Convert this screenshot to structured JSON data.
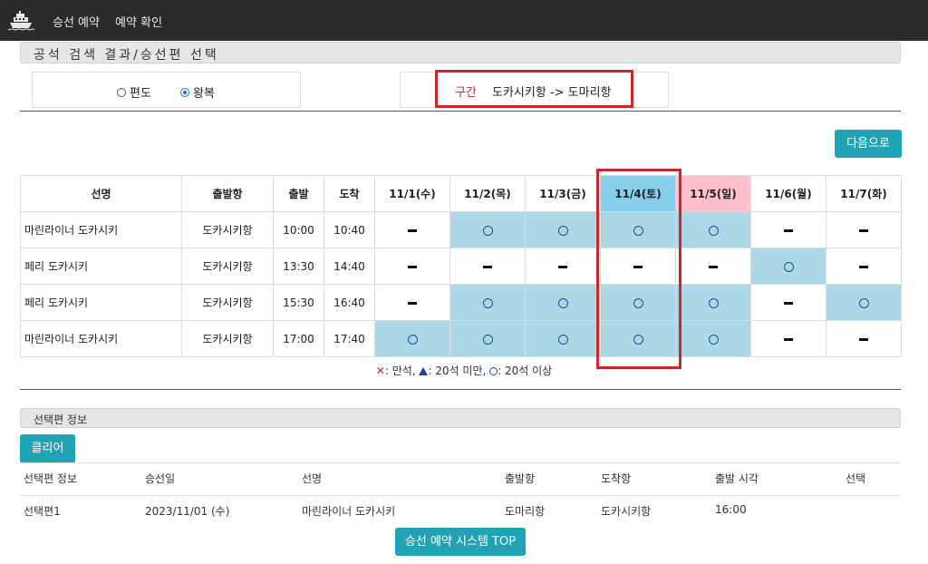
{
  "nav": {
    "logo_icon": "ship-icon",
    "items": [
      "승선 예약",
      "예약 확인"
    ]
  },
  "search": {
    "title": "공석 검색 결과/승선편 선택",
    "trip_options": [
      {
        "label": "편도",
        "checked": false
      },
      {
        "label": "왕복",
        "checked": true
      }
    ],
    "route_label": "구간",
    "route_value": "도카시키항 -> 도마리항",
    "next_button": "다음으로"
  },
  "schedule": {
    "headers": [
      "선명",
      "출발항",
      "출발",
      "도착"
    ],
    "dates": [
      "11/1(수)",
      "11/2(목)",
      "11/3(금)",
      "11/4(토)",
      "11/5(일)",
      "11/6(월)",
      "11/7(화)"
    ],
    "selected_date_index": 3,
    "sunday_index": 4,
    "rows": [
      {
        "ship": "마린라이너 도카시키",
        "port": "도카시키항",
        "dep": "10:00",
        "arr": "10:40",
        "status": [
          "dash",
          "circle",
          "circle",
          "circle",
          "circle",
          "dash",
          "dash"
        ]
      },
      {
        "ship": "페리 도카시키",
        "port": "도카시키항",
        "dep": "13:30",
        "arr": "14:40",
        "status": [
          "dash",
          "dash",
          "dash",
          "dash",
          "dash",
          "circle",
          "dash"
        ]
      },
      {
        "ship": "페리 도카시키",
        "port": "도카시키항",
        "dep": "15:30",
        "arr": "16:40",
        "status": [
          "dash",
          "circle",
          "circle",
          "circle",
          "circle",
          "dash",
          "circle"
        ]
      },
      {
        "ship": "마린라이너 도카시키",
        "port": "도카시키항",
        "dep": "17:00",
        "arr": "17:40",
        "status": [
          "circle",
          "circle",
          "circle",
          "circle",
          "circle",
          "dash",
          "dash"
        ]
      }
    ],
    "legend": {
      "full_mark": "✕",
      "full": ": 만석,",
      "few_mark": "▲",
      "few": ": 20석 미만,",
      "many_mark": "○",
      "many": ": 20석 이상"
    }
  },
  "selected": {
    "title": "선택편 정보",
    "clear_button": "클리어",
    "columns": [
      "선택편 정보",
      "승선일",
      "선명",
      "출발항",
      "도착항",
      "출발 시각",
      "선택"
    ],
    "rows": [
      [
        "선택편1",
        "2023/11/01 (수)",
        "마린라이너 도카시키",
        "도마리항",
        "도카시키항",
        "16:00",
        ""
      ]
    ]
  },
  "footer": {
    "top_button": "승선 예약 시스템 TOP"
  }
}
